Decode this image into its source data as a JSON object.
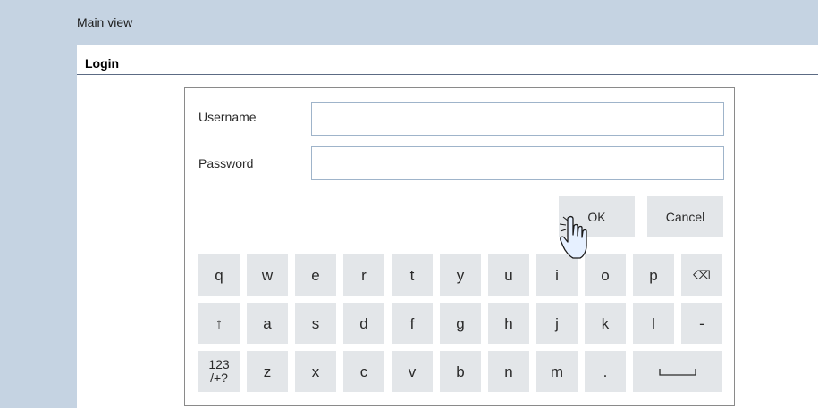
{
  "header": {
    "title": "Main view"
  },
  "panel": {
    "title": "Login"
  },
  "form": {
    "username_label": "Username",
    "username_value": "",
    "password_label": "Password",
    "password_value": "",
    "ok_label": "OK",
    "cancel_label": "Cancel"
  },
  "keyboard": {
    "row1": [
      "q",
      "w",
      "e",
      "r",
      "t",
      "y",
      "u",
      "i",
      "o",
      "p",
      "⌫"
    ],
    "row2": [
      "↑",
      "a",
      "s",
      "d",
      "f",
      "g",
      "h",
      "j",
      "k",
      "l",
      "-"
    ],
    "row3": [
      "123\n/+?",
      "z",
      "x",
      "c",
      "v",
      "b",
      "n",
      "m",
      "."
    ]
  },
  "cursor": {
    "icon": "hand-pointer-icon"
  }
}
